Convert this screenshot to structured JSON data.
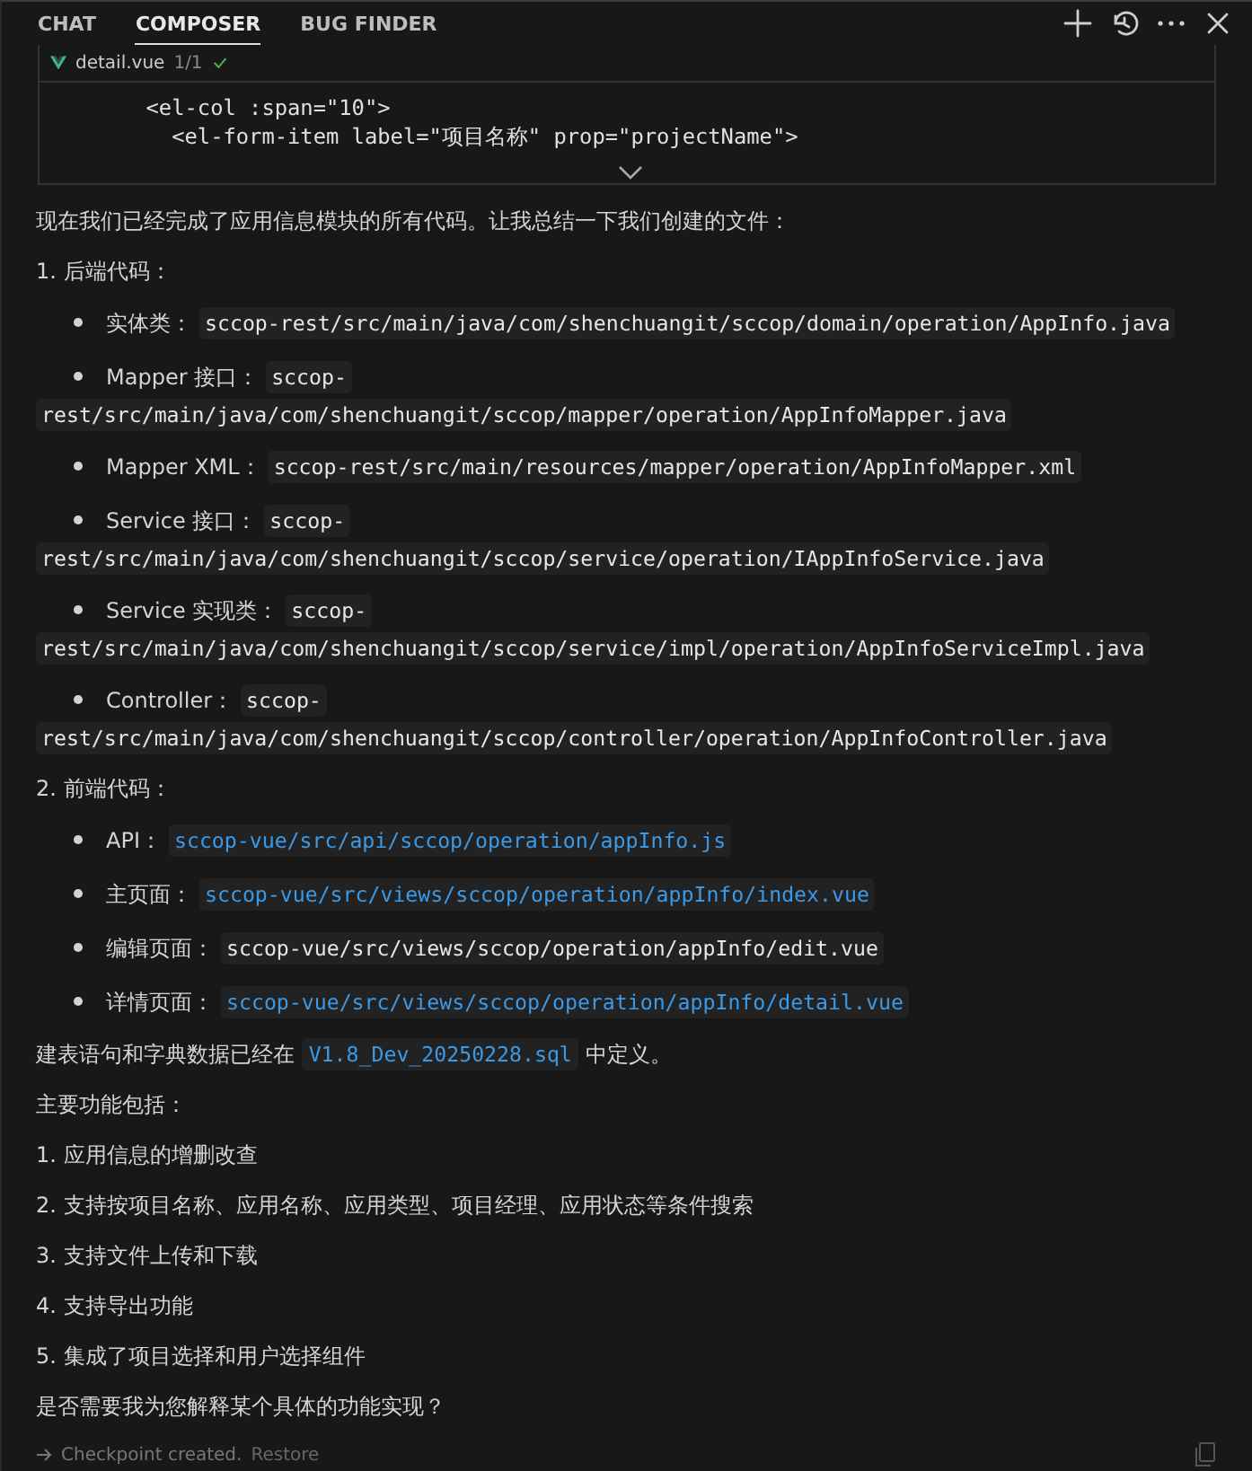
{
  "tabs": [
    {
      "label": "CHAT",
      "selected": false
    },
    {
      "label": "COMPOSER",
      "selected": true
    },
    {
      "label": "BUG FINDER",
      "selected": false
    }
  ],
  "code_preview": {
    "file": "detail.vue",
    "count": "1/1",
    "applied": true,
    "lines": [
      "        <el-col :span=\"10\">",
      "          <el-form-item label=\"项目名称\" prop=\"projectName\">"
    ]
  },
  "message": [
    {
      "kind": "para",
      "text": "现在我们已经完成了应用信息模块的所有代码。让我总结一下我们创建的文件："
    },
    {
      "kind": "heading",
      "text": "1. 后端代码："
    },
    {
      "kind": "bullets",
      "items": [
        {
          "label": "实体类：",
          "path": "sccop-rest/src/main/java/com/shenchuangit/sccop/domain/operation/AppInfo.java",
          "linked": false
        },
        {
          "label": "Mapper 接口：",
          "path": [
            "sccop-",
            "rest/src/main/java/com/shenchuangit/sccop/mapper/operation/AppInfoMapper.java"
          ],
          "linked": false
        },
        {
          "label": "Mapper XML：",
          "path": "sccop-rest/src/main/resources/mapper/operation/AppInfoMapper.xml",
          "linked": false
        },
        {
          "label": "Service 接口：",
          "path": [
            "sccop-",
            "rest/src/main/java/com/shenchuangit/sccop/service/operation/IAppInfoService.java"
          ],
          "linked": false
        },
        {
          "label": "Service 实现类：",
          "path": [
            "sccop-",
            "rest/src/main/java/com/shenchuangit/sccop/service/impl/operation/AppInfoServiceImpl.java"
          ],
          "linked": false
        },
        {
          "label": "Controller：",
          "path": [
            "sccop-",
            "rest/src/main/java/com/shenchuangit/sccop/controller/operation/AppInfoController.java"
          ],
          "linked": false
        }
      ]
    },
    {
      "kind": "heading",
      "text": "2. 前端代码："
    },
    {
      "kind": "bullets",
      "items": [
        {
          "label": "API：",
          "path": "sccop-vue/src/api/sccop/operation/appInfo.js",
          "linked": true
        },
        {
          "label": "主页面：",
          "path": "sccop-vue/src/views/sccop/operation/appInfo/index.vue",
          "linked": true
        },
        {
          "label": "编辑页面：",
          "path": "sccop-vue/src/views/sccop/operation/appInfo/edit.vue",
          "linked": false
        },
        {
          "label": "详情页面：",
          "path": "sccop-vue/src/views/sccop/operation/appInfo/detail.vue",
          "linked": true
        }
      ]
    },
    {
      "kind": "inline",
      "before": "建表语句和字典数据已经在 ",
      "code": "V1.8_Dev_20250228.sql",
      "after": " 中定义。",
      "linked": true
    },
    {
      "kind": "para",
      "text": "主要功能包括："
    },
    {
      "kind": "numbered",
      "text": "1. 应用信息的增删改查"
    },
    {
      "kind": "numbered",
      "text": "2. 支持按项目名称、应用名称、应用类型、项目经理、应用状态等条件搜索"
    },
    {
      "kind": "numbered",
      "text": "3. 支持文件上传和下载"
    },
    {
      "kind": "numbered",
      "text": "4. 支持导出功能"
    },
    {
      "kind": "numbered",
      "text": "5. 集成了项目选择和用户选择组件"
    },
    {
      "kind": "para",
      "text": "是否需要我为您解释某个具体的功能实现？"
    }
  ],
  "checkpoint": {
    "text": "Checkpoint created.",
    "action": "Restore"
  }
}
